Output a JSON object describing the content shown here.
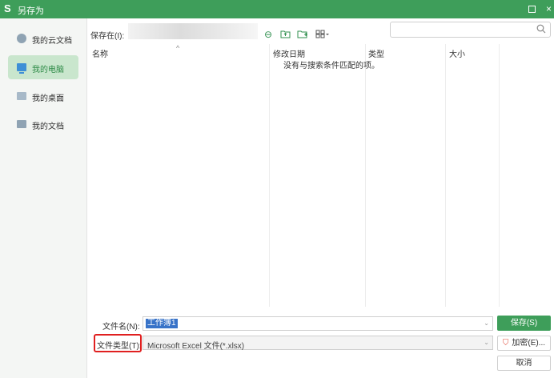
{
  "window": {
    "logo": "S",
    "title": "另存为",
    "logo_icon": "wps-logo-icon",
    "max_icon": "maximize-icon",
    "close_glyph": "×"
  },
  "sidebar": {
    "items": [
      {
        "label": "我的云文档",
        "icon": "cloud-icon",
        "active": false
      },
      {
        "label": "我的电脑",
        "icon": "computer-icon",
        "active": true
      },
      {
        "label": "我的桌面",
        "icon": "desktop-icon",
        "active": false
      },
      {
        "label": "我的文档",
        "icon": "folder-icon",
        "active": false
      }
    ]
  },
  "location": {
    "label": "保存在(I):",
    "path": ""
  },
  "toolbar": {
    "icons": [
      "back-icon",
      "up-folder-icon",
      "new-folder-icon",
      "view-mode-icon"
    ]
  },
  "search": {
    "placeholder": "",
    "icon": "search-icon"
  },
  "filelist": {
    "columns": [
      "名称",
      "修改日期",
      "类型",
      "大小"
    ],
    "empty_message": "没有与搜索条件匹配的项。"
  },
  "form": {
    "filename_label": "文件名(N):",
    "filename_value": "工作簿1",
    "filetype_label": "文件类型(T):",
    "filetype_value": "Microsoft Excel 文件(*.xlsx)"
  },
  "buttons": {
    "save": "保存(S)",
    "encrypt": "加密(E)...",
    "cancel": "取消"
  },
  "colors": {
    "accent": "#3e9e5a",
    "highlight_box": "#e02020",
    "selection": "#3873c8"
  }
}
